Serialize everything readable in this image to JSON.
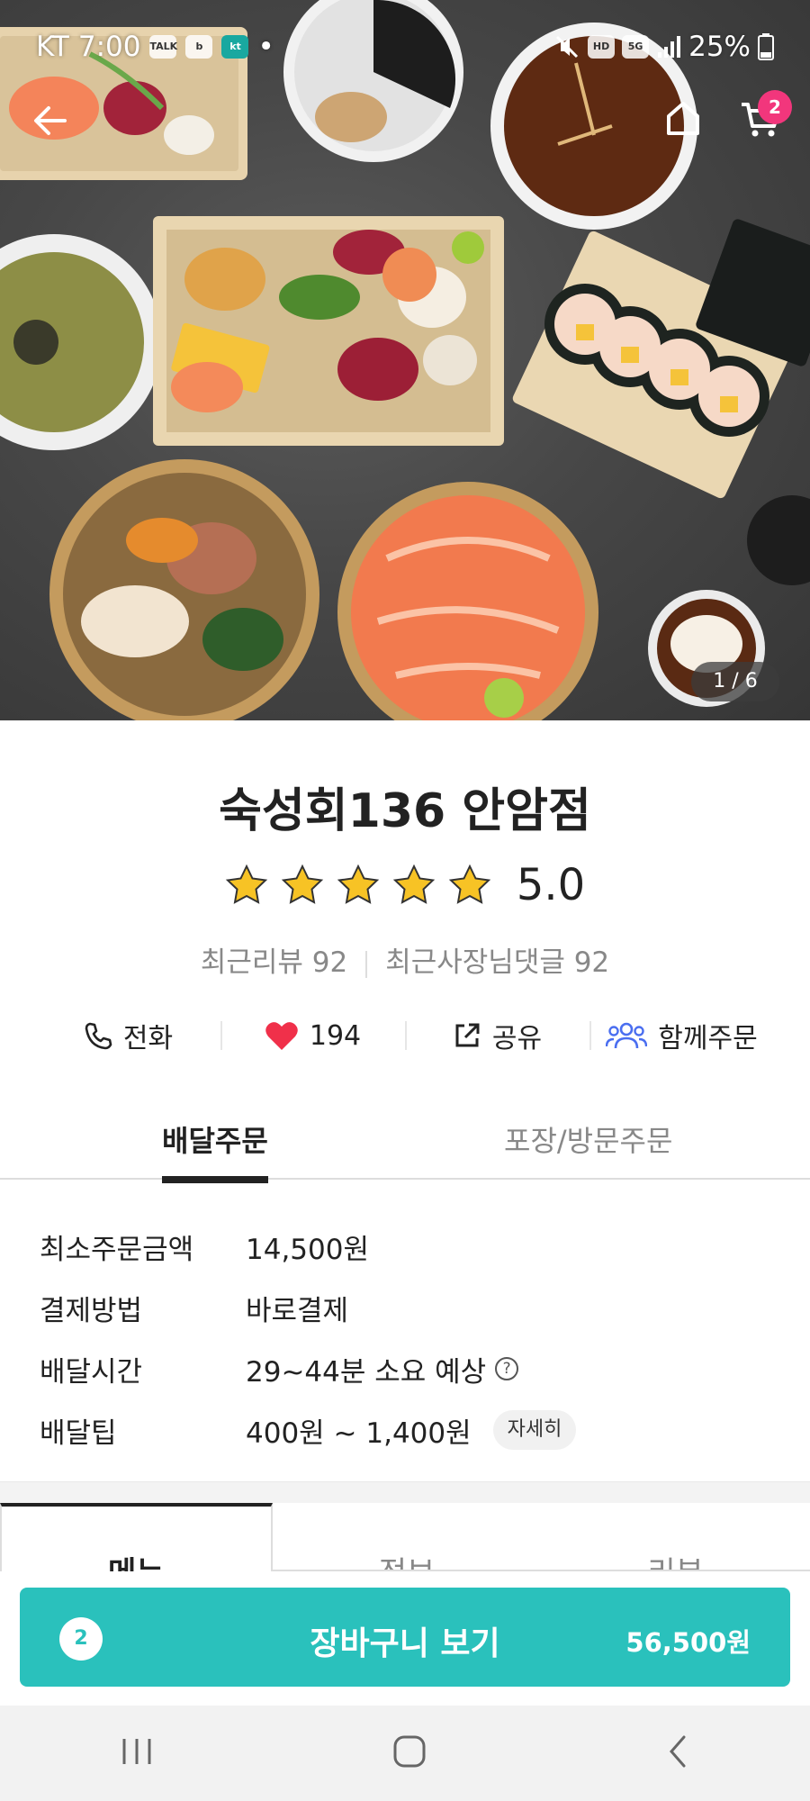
{
  "status_bar": {
    "carrier": "KT",
    "time": "7:00",
    "talk_icon_label": "TALK",
    "kt_icon_label": "kt",
    "hd_label": "HD",
    "network_label": "5G",
    "battery": "25%"
  },
  "header": {
    "cart_badge": "2"
  },
  "hero": {
    "pager": "1 / 6"
  },
  "store": {
    "name": "숙성회136 안암점",
    "rating_stars": 5,
    "rating": "5.0",
    "recent_reviews": "최근리뷰 92",
    "owner_replies": "최근사장님댓글 92"
  },
  "actions": {
    "call": "전화",
    "likes": "194",
    "share": "공유",
    "group_order": "함께주문"
  },
  "order_tabs": {
    "delivery": "배달주문",
    "pickup": "포장/방문주문"
  },
  "info": {
    "min_order_label": "최소주문금액",
    "min_order_value": "14,500원",
    "payment_label": "결제방법",
    "payment_value": "바로결제",
    "delivery_time_label": "배달시간",
    "delivery_time_value": "29~44분 소요 예상",
    "delivery_tip_label": "배달팁",
    "delivery_tip_value": "400원 ~ 1,400원",
    "detail_button": "자세히"
  },
  "menu_tabs": [
    "메뉴",
    "정보",
    "리뷰"
  ],
  "cart_bar": {
    "count": "2",
    "label": "장바구니 보기",
    "total": "56,500원"
  },
  "colors": {
    "accent": "#2ac1bc",
    "badge": "#f2367c",
    "star": "#f7c325",
    "heart": "#f0304a",
    "group_icon": "#4a6ef0"
  }
}
